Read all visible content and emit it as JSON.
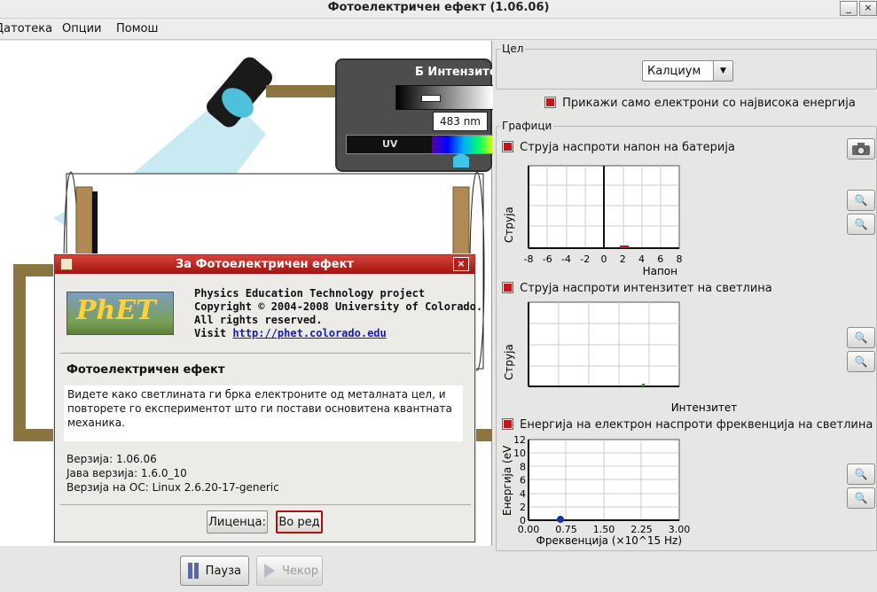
{
  "window": {
    "title": "Фотоелектричен ефект (1.06.06)",
    "minimize": "_",
    "close": "×"
  },
  "menu": {
    "items": [
      "Датотека",
      "Опции",
      "Помош"
    ]
  },
  "source": {
    "intensity_label": "Б Интензите",
    "wavelength": "483 nm",
    "uv_label": "UV",
    "intensity_value_fraction": 0.25
  },
  "controls": {
    "pause": "Пауза",
    "step": "Чекор"
  },
  "target": {
    "group_title": "Цел",
    "selected": "Калциум",
    "checkbox_label": "Прикажи само електрони со највисока енергија"
  },
  "graphs": {
    "group_title": "Графици",
    "g1": {
      "label": "Струја наспроти напон на батерија",
      "ylabel": "Струја",
      "xlabel": "Напон",
      "xticks": [
        "-8",
        "-6",
        "-4",
        "-2",
        "0",
        "2",
        "4",
        "6",
        "8"
      ]
    },
    "g2": {
      "label": "Струја наспроти интензитет на светлина",
      "ylabel": "Струја",
      "xlabel": "Интензитет"
    },
    "g3": {
      "label": "Енергија на електрон наспроти фреквенција на светлина",
      "ylabel": "Енергија (eV",
      "xlabel": "Фреквенција (×10^15 Hz)",
      "yticks": [
        "12",
        "10",
        "8",
        "6",
        "4",
        "2",
        "0"
      ],
      "xticks": [
        "0.00",
        "0.75",
        "1.50",
        "2.25",
        "3.00"
      ]
    }
  },
  "dialog": {
    "title": "За Фотоелектричен ефект",
    "logo_text": "PhET",
    "line1": "Physics Education Technology project",
    "line2": "Copyright © 2004-2008 University of Colorado.",
    "line3": "All rights reserved.",
    "visit": "Visit",
    "url": "http://phet.colorado.edu",
    "sim_name": "Фотоелектричен ефект",
    "description": "Видете како светлината ги брка електроните од металната цел, и повторете го експериментот што ги постави основитена квантната механика.",
    "version": "Верзија: 1.06.06",
    "java_version": "Јава верзија: 1.6.0_10",
    "os_version": "Верзија на ОС: Linux 2.6.20-17-generic",
    "license_btn": "Лиценца:",
    "ok_btn": "Во ред"
  }
}
